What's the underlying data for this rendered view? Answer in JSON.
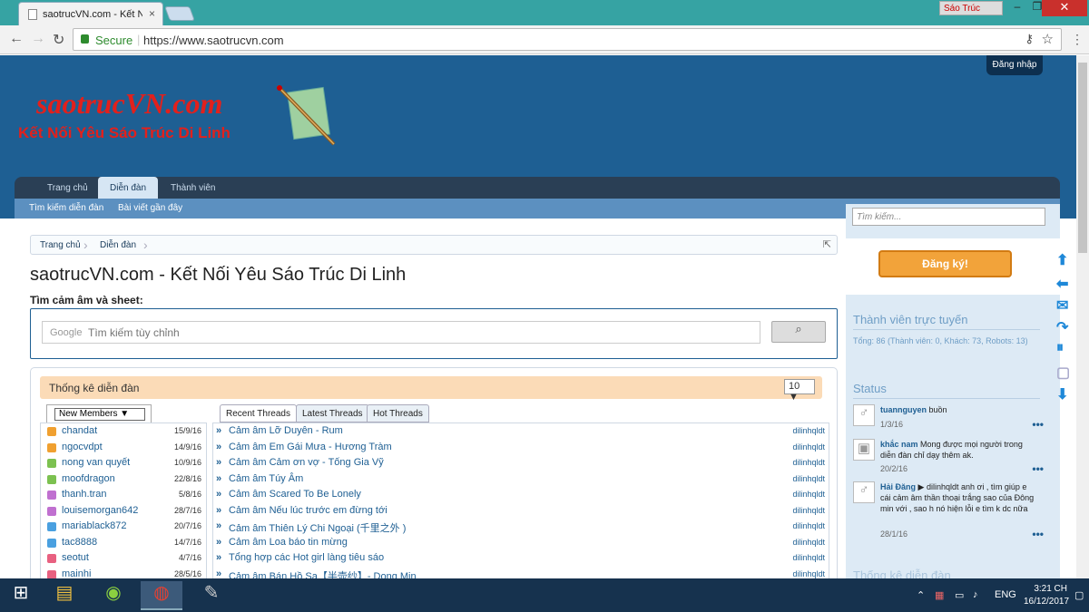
{
  "browser": {
    "tab_title": "saotrucVN.com - Kết Nối",
    "tab_close": "×",
    "profile": "Sáo Trúc",
    "secure": "Secure",
    "url": "https://www.saotrucvn.com",
    "minimize": "–",
    "maximize": "❐",
    "close": "✕"
  },
  "header": {
    "login": "Đăng nhập",
    "logo_title": "saotrucVN.com",
    "logo_sub": "Kết Nối Yêu Sáo Trúc Di Linh"
  },
  "nav": {
    "tabs": [
      "Trang chủ",
      "Diễn đàn",
      "Thành viên"
    ],
    "sub": [
      "Tìm kiếm diễn đàn",
      "Bài viết gần đây"
    ]
  },
  "breadcrumb": [
    "Trang chủ",
    "Diễn đàn"
  ],
  "page_title": "saotrucVN.com - Kết Nối Yêu Sáo Trúc Di Linh",
  "search": {
    "label": "Tìm cảm âm và sheet:",
    "google": "Google",
    "placeholder": "Tìm kiếm tùy chỉnh",
    "button_icon": "search-icon"
  },
  "stats": {
    "title": "Thống kê diễn đàn",
    "count_select": "10 ▼",
    "members_select": "New Members",
    "members": [
      {
        "name": "chandat",
        "date": "15/9/16",
        "color": "#f0a030"
      },
      {
        "name": "ngocvdpt",
        "date": "14/9/16",
        "color": "#f0a030"
      },
      {
        "name": "nong van quyết",
        "date": "10/9/16",
        "color": "#7cc150"
      },
      {
        "name": "moofdragon",
        "date": "22/8/16",
        "color": "#7cc150"
      },
      {
        "name": "thanh.tran",
        "date": "5/8/16",
        "color": "#c070d0"
      },
      {
        "name": "louisemorgan642",
        "date": "28/7/16",
        "color": "#c070d0"
      },
      {
        "name": "mariablack872",
        "date": "20/7/16",
        "color": "#4aa0e0"
      },
      {
        "name": "tac8888",
        "date": "14/7/16",
        "color": "#4aa0e0"
      },
      {
        "name": "seotut",
        "date": "4/7/16",
        "color": "#e86080"
      },
      {
        "name": "mainhi",
        "date": "28/5/16",
        "color": "#e86080"
      }
    ],
    "thread_tabs": [
      "Recent Threads",
      "Latest Threads",
      "Hot Threads"
    ],
    "threads": [
      {
        "title": "Cảm âm Lỡ Duyên - Rum",
        "author": "dilinhqldt"
      },
      {
        "title": "Cảm âm Em Gái Mưa - Hương Tràm",
        "author": "dilinhqldt"
      },
      {
        "title": "Cảm âm Cảm ơn vợ - Tống Gia Vỹ",
        "author": "dilinhqldt"
      },
      {
        "title": "Cảm âm Túy Âm",
        "author": "dilinhqldt"
      },
      {
        "title": "Cảm âm Scared To Be Lonely",
        "author": "dilinhqldt"
      },
      {
        "title": "Cảm âm Nếu lúc trước em đừng tới",
        "author": "dilinhqldt"
      },
      {
        "title": "Cảm âm Thiên Lý Chi Ngoại (千里之外 )",
        "author": "dilinhqldt"
      },
      {
        "title": "Cảm âm Loa báo tin mừng",
        "author": "dilinhqldt"
      },
      {
        "title": "Tổng hợp các Hot girl làng tiêu sáo",
        "author": "dilinhqldt"
      },
      {
        "title": "Cảm âm Bán Hồ Sa【半壶纱】- Dong Min",
        "author": "dilinhqldt"
      }
    ]
  },
  "sidebar": {
    "search_placeholder": "Tìm kiếm...",
    "register": "Đăng ký!",
    "online_title": "Thành viên trực tuyến",
    "online_text": "Tổng: 86 (Thành viên: 0, Khách: 73, Robots: 13)",
    "status_title": "Status",
    "statuses": [
      {
        "author": "tuannguyen",
        "text": " buồn",
        "date": "1/3/16"
      },
      {
        "author": "khắc nam",
        "text": " Mong được mọi người trong diễn đàn chỉ dạy thêm ak.",
        "date": "20/2/16"
      },
      {
        "author": "Hải Đăng",
        "text": " ▶ dilinhqldt anh ơi , tìm giúp e cái cảm âm thần thoại trắng sao của Đông min với , sao h nó hiện lỗi e tìm k dc nữa",
        "date": "28/1/16"
      }
    ],
    "more": "•••",
    "footer_title": "Thống kê diễn đàn"
  },
  "taskbar": {
    "lang": "ENG",
    "time": "3:21 CH",
    "date": "16/12/2017"
  }
}
